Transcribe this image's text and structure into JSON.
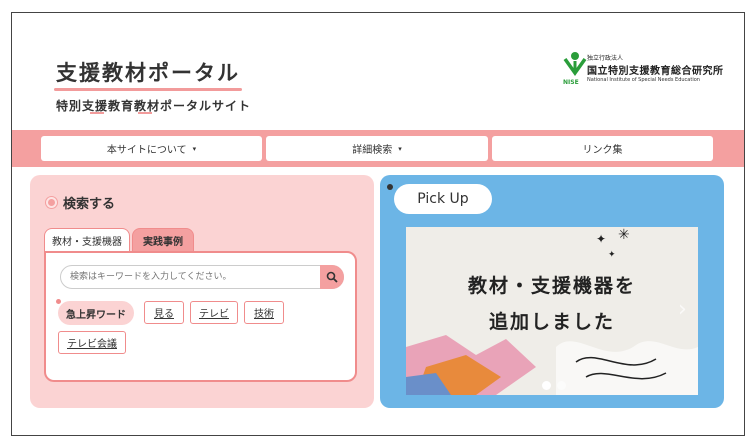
{
  "header": {
    "title": "支援教材ポータル",
    "subtitle": "特別支援教育教材ポータルサイト",
    "org_small": "独立行政法人",
    "org_name": "国立特別支援教育総合研究所",
    "org_english": "National Institute of Special Needs Education",
    "org_abbr": "NISE"
  },
  "nav": {
    "items": [
      {
        "label": "本サイトについて",
        "has_caret": true
      },
      {
        "label": "詳細検索",
        "has_caret": true
      },
      {
        "label": "リンク集",
        "has_caret": false
      }
    ],
    "caret": "▾"
  },
  "search": {
    "heading": "検索する",
    "tabs": [
      "教材・支援機器",
      "実践事例"
    ],
    "placeholder": "検索はキーワードを入力してください。",
    "trending_label": "急上昇ワード",
    "keywords": [
      "見る",
      "テレビ",
      "技術",
      "テレビ会議"
    ]
  },
  "pickup": {
    "label": "Pick Up",
    "banner_line1": "教材・支援機器を",
    "banner_line2": "追加しました",
    "slides": 2,
    "active_slide": 0
  },
  "colors": {
    "accent_pink": "#f4a0a0",
    "panel_pink": "#fbd3d3",
    "panel_blue": "#6cb5e6",
    "logo_green": "#2a9d3a"
  }
}
